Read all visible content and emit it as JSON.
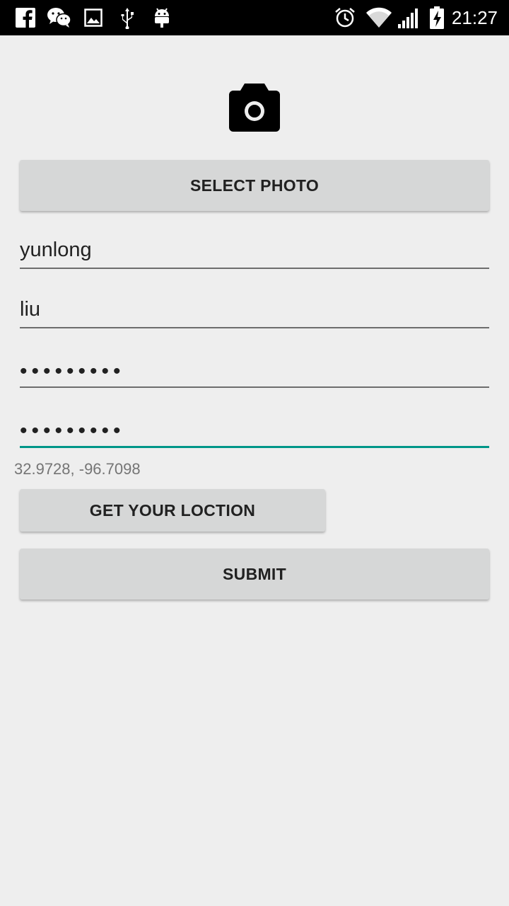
{
  "status_bar": {
    "time": "21:27",
    "left_icons": [
      "facebook-icon",
      "wechat-icon",
      "image-icon",
      "usb-icon",
      "android-icon"
    ],
    "right_icons": [
      "alarm-icon",
      "wifi-icon",
      "signal-icon",
      "battery-charging-icon"
    ]
  },
  "form": {
    "camera_icon": "camera-icon",
    "select_photo_label": "SELECT PHOTO",
    "first_name_value": "yunlong",
    "last_name_value": "liu",
    "password_value": "•••••••••",
    "confirm_password_value": "•••••••••",
    "coordinates_text": "32.9728, -96.7098",
    "get_location_label": "GET YOUR LOCTION",
    "submit_label": "SUBMIT"
  },
  "colors": {
    "accent": "#009688",
    "button_bg": "#d6d7d7",
    "background": "#eeeeee"
  }
}
